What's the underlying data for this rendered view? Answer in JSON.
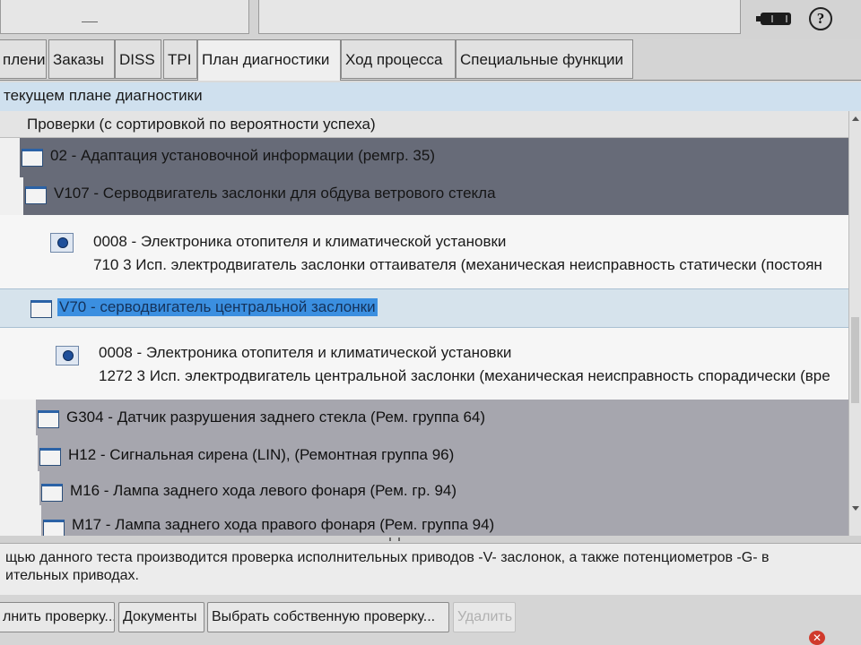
{
  "tabs": [
    "пления",
    "Заказы",
    "DISS",
    "TPI",
    "План диагностики",
    "Ход процесса",
    "Специальные функции"
  ],
  "section_title": "текущем плане диагностики",
  "list": {
    "column_header": "Проверки (с сортировкой по вероятности успеха)",
    "rows": [
      {
        "label": "02 - Адаптация установочной информации (ремгр. 35)"
      },
      {
        "label": "V107 - Серводвигатель заслонки для обдува ветрового стекла"
      },
      {
        "line1": "0008 - Электроника отопителя и климатической установки",
        "line2": "710   3   Исп. электродвигатель заслонки оттаивателя  (механическая неисправность   статически (постоян"
      },
      {
        "label": "V70 - серводвигатель центральной заслонки"
      },
      {
        "line1": "0008 - Электроника отопителя и климатической установки",
        "line2": "1272   3   Исп. электродвигатель центральной заслонки  (механическая неисправность   спорадически (вре"
      },
      {
        "label": "G304 - Датчик разрушения заднего стекла (Рем. группа 64)"
      },
      {
        "label": "H12 - Сигнальная сирена (LIN), (Ремонтная группа 96)"
      },
      {
        "label": "M16 - Лампа заднего хода левого фонаря (Рем. гр. 94)"
      },
      {
        "label": "M17 - Лампа заднего хода правого фонаря (Рем. группа 94)"
      }
    ]
  },
  "description": {
    "line1": "щью данного теста производится проверка исполнительных приводов -V- заслонок, а также потенциометров -G- в",
    "line2": "ительных приводах."
  },
  "buttons": [
    "лнить проверку...",
    "Документы",
    "Выбрать собственную проверку...",
    "Удалить"
  ],
  "active_tab": "План диагностики",
  "colors": {
    "group_row": "#676b78",
    "selection": "#3b8fe0",
    "section_bar": "#cfe0ee"
  }
}
